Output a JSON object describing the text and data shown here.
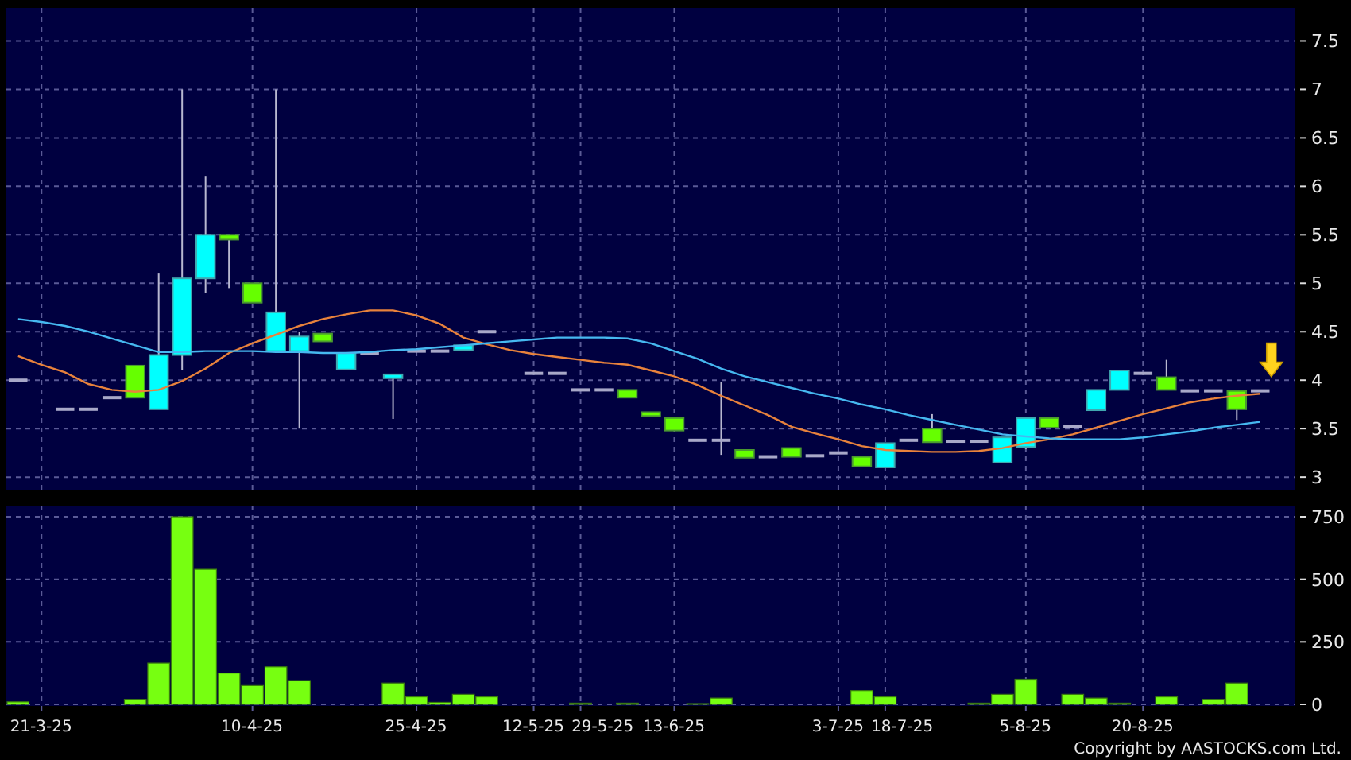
{
  "price_panel": {
    "chart_data": {
      "type": "candlestick",
      "categories": [
        null,
        null,
        null,
        null,
        null,
        null,
        null,
        null,
        null,
        null,
        null,
        null,
        null,
        null,
        null,
        null,
        null,
        null,
        null,
        null,
        null,
        null,
        null,
        null,
        null,
        null,
        null,
        null,
        null,
        null,
        null,
        null,
        null,
        null,
        null,
        null,
        null,
        null,
        null,
        null,
        null,
        null,
        null,
        null,
        null,
        null,
        null,
        null,
        null,
        null,
        null,
        null,
        null,
        null,
        null
      ],
      "grid": true,
      "ylim": [
        2.87,
        7.84
      ],
      "yticks": [
        3,
        3.5,
        4,
        4.5,
        5,
        5.5,
        6,
        6.5,
        7,
        7.5
      ],
      "ohlc": [
        [
          4.0,
          4.0,
          4.0,
          4.0
        ],
        null,
        [
          3.7,
          3.7,
          3.7,
          3.7
        ],
        [
          3.7,
          3.7,
          3.7,
          3.7
        ],
        [
          3.82,
          3.82,
          3.82,
          3.82
        ],
        [
          4.15,
          4.15,
          3.82,
          3.82
        ],
        [
          3.7,
          5.1,
          3.7,
          4.26
        ],
        [
          4.26,
          7.0,
          4.1,
          5.05
        ],
        [
          5.05,
          6.1,
          4.9,
          5.5
        ],
        [
          5.5,
          5.5,
          4.95,
          5.45
        ],
        [
          5.0,
          5.0,
          4.8,
          4.8
        ],
        [
          4.3,
          7.0,
          4.3,
          4.7
        ],
        [
          4.3,
          4.5,
          3.5,
          4.45
        ],
        [
          4.48,
          4.48,
          4.4,
          4.4
        ],
        [
          4.11,
          4.28,
          4.11,
          4.28
        ],
        [
          4.28,
          4.28,
          4.28,
          4.28
        ],
        [
          4.02,
          4.06,
          3.6,
          4.06
        ],
        [
          4.3,
          4.3,
          4.3,
          4.3
        ],
        [
          4.3,
          4.3,
          4.3,
          4.3
        ],
        [
          4.31,
          4.36,
          4.31,
          4.36
        ],
        [
          4.5,
          4.5,
          4.5,
          4.5
        ],
        null,
        [
          4.07,
          4.07,
          4.07,
          4.07
        ],
        [
          4.07,
          4.07,
          4.07,
          4.07
        ],
        [
          3.9,
          3.9,
          3.9,
          3.9
        ],
        [
          3.9,
          3.9,
          3.9,
          3.9
        ],
        [
          3.9,
          3.9,
          3.82,
          3.82
        ],
        [
          3.67,
          3.67,
          3.63,
          3.63
        ],
        [
          3.61,
          3.61,
          3.48,
          3.48
        ],
        [
          3.38,
          3.38,
          3.38,
          3.38
        ],
        [
          3.38,
          3.98,
          3.23,
          3.38
        ],
        [
          3.28,
          3.28,
          3.2,
          3.2
        ],
        [
          3.21,
          3.21,
          3.21,
          3.21
        ],
        [
          3.3,
          3.3,
          3.21,
          3.21
        ],
        [
          3.22,
          3.22,
          3.22,
          3.22
        ],
        [
          3.25,
          3.25,
          3.25,
          3.25
        ],
        [
          3.21,
          3.21,
          3.11,
          3.11
        ],
        [
          3.1,
          3.35,
          3.1,
          3.35
        ],
        [
          3.38,
          3.38,
          3.38,
          3.38
        ],
        [
          3.5,
          3.65,
          3.36,
          3.36
        ],
        [
          3.37,
          3.37,
          3.37,
          3.37
        ],
        [
          3.37,
          3.37,
          3.37,
          3.37
        ],
        [
          3.15,
          3.41,
          3.15,
          3.41
        ],
        [
          3.31,
          3.61,
          3.29,
          3.61
        ],
        [
          3.61,
          3.61,
          3.51,
          3.51
        ],
        [
          3.52,
          3.52,
          3.52,
          3.52
        ],
        [
          3.69,
          3.9,
          3.69,
          3.9
        ],
        [
          3.9,
          4.1,
          3.9,
          4.1
        ],
        [
          4.07,
          4.07,
          4.07,
          4.07
        ],
        [
          4.03,
          4.21,
          3.9,
          3.9
        ],
        [
          3.89,
          3.89,
          3.89,
          3.89
        ],
        [
          3.89,
          3.89,
          3.89,
          3.89
        ],
        [
          3.89,
          3.89,
          3.59,
          3.7
        ],
        [
          3.89,
          3.89,
          3.89,
          3.89
        ],
        null
      ],
      "series": [
        {
          "type": "line",
          "color": "#e8823c",
          "values": [
            4.25,
            4.16,
            4.08,
            3.96,
            3.9,
            3.88,
            3.9,
            3.99,
            4.12,
            4.28,
            4.38,
            4.47,
            4.56,
            4.63,
            4.68,
            4.72,
            4.72,
            4.67,
            4.58,
            4.44,
            4.37,
            4.31,
            4.27,
            4.24,
            4.21,
            4.18,
            4.16,
            4.1,
            4.04,
            3.95,
            3.84,
            3.74,
            3.64,
            3.52,
            3.45,
            3.39,
            3.32,
            3.28,
            3.27,
            3.26,
            3.26,
            3.27,
            3.3,
            3.35,
            3.39,
            3.44,
            3.51,
            3.58,
            3.65,
            3.71,
            3.77,
            3.81,
            3.84,
            3.86,
            null
          ]
        },
        {
          "type": "line",
          "color": "#46b8f0",
          "values": [
            4.63,
            4.6,
            4.56,
            4.5,
            4.43,
            4.36,
            4.29,
            4.29,
            4.3,
            4.3,
            4.3,
            4.29,
            4.29,
            4.28,
            4.28,
            4.29,
            4.31,
            4.32,
            4.34,
            4.36,
            4.38,
            4.4,
            4.42,
            4.44,
            4.44,
            4.44,
            4.43,
            4.38,
            4.3,
            4.22,
            4.12,
            4.04,
            3.98,
            3.92,
            3.86,
            3.81,
            3.75,
            3.7,
            3.64,
            3.59,
            3.54,
            3.49,
            3.44,
            3.42,
            3.4,
            3.39,
            3.39,
            3.39,
            3.41,
            3.44,
            3.47,
            3.51,
            3.54,
            3.57,
            null
          ]
        }
      ]
    }
  },
  "volume_panel": {
    "chart_data": {
      "type": "bar",
      "grid": true,
      "ylim": [
        -6.4,
        794.5
      ],
      "yticks": [
        0,
        250,
        500,
        750
      ],
      "categories": [
        null,
        "21-3-25",
        null,
        null,
        null,
        null,
        null,
        null,
        null,
        null,
        "10-4-25",
        null,
        null,
        null,
        null,
        null,
        null,
        "25-4-25",
        null,
        null,
        null,
        null,
        "12-5-25",
        null,
        "29-5-25",
        null,
        null,
        null,
        "13-6-25",
        null,
        null,
        null,
        null,
        null,
        null,
        "3-7-25",
        null,
        "18-7-25",
        null,
        null,
        null,
        null,
        null,
        "5-8-25",
        null,
        null,
        null,
        null,
        "20-8-25",
        null,
        null,
        null,
        null,
        null,
        null
      ],
      "values": [
        10,
        0,
        0,
        0,
        0,
        20,
        165,
        750,
        540,
        125,
        75,
        150,
        95,
        0,
        0,
        0,
        85,
        30,
        8,
        40,
        30,
        0,
        0,
        0,
        5,
        0,
        5,
        0,
        0,
        3,
        25,
        0,
        0,
        0,
        0,
        0,
        55,
        30,
        0,
        0,
        0,
        5,
        40,
        100,
        0,
        40,
        25,
        5,
        0,
        30,
        0,
        20,
        85,
        0,
        0
      ]
    }
  },
  "copyright": "Copyright by AASTOCKS.com Ltd."
}
